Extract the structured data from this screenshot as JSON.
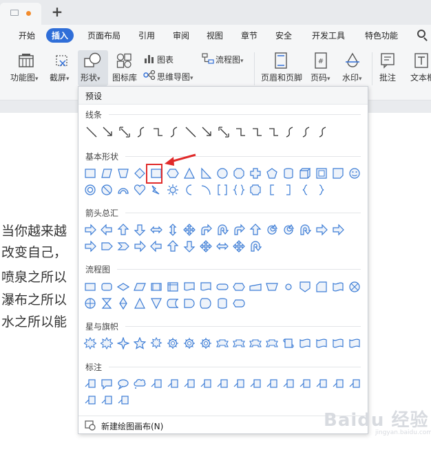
{
  "tabs": {
    "add_label": "+"
  },
  "menubar": {
    "items": [
      {
        "label": "开始",
        "active": false
      },
      {
        "label": "插入",
        "active": true
      },
      {
        "label": "页面布局",
        "active": false
      },
      {
        "label": "引用",
        "active": false
      },
      {
        "label": "审阅",
        "active": false
      },
      {
        "label": "视图",
        "active": false
      },
      {
        "label": "章节",
        "active": false
      },
      {
        "label": "安全",
        "active": false
      },
      {
        "label": "开发工具",
        "active": false
      },
      {
        "label": "特色功能",
        "active": false
      }
    ]
  },
  "ribbon": {
    "function_chart": "功能图",
    "screenshot": "截屏",
    "shapes": "形状",
    "icon_library": "图标库",
    "chart": "图表",
    "mind_map": "思维导图",
    "flowchart": "流程图",
    "header_footer": "页眉和页脚",
    "page_number": "页码",
    "watermark": "水印",
    "comment": "批注",
    "textbox": "文本框"
  },
  "document": {
    "lines": [
      "当你越来越",
      "改变自己，",
      "喷泉之所以",
      "瀑布之所以",
      "水之所以能"
    ]
  },
  "shapes_panel": {
    "title": "预设",
    "sections": {
      "lines": "线条",
      "basic": "基本形状",
      "arrows": "箭头总汇",
      "flowchart": "流程图",
      "stars": "星与旗帜",
      "callouts": "标注"
    },
    "new_canvas": "新建绘图画布(N)"
  },
  "watermark_text": "Baidu 经验",
  "watermark_sub": "jingyan.baidu.com",
  "colors": {
    "accent": "#2f6ed8",
    "highlight_box": "#e02a2a",
    "shape_stroke": "#3a7bd5"
  }
}
